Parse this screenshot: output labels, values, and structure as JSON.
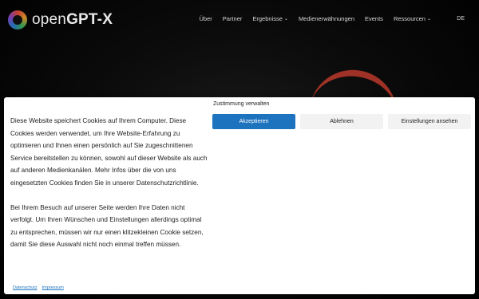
{
  "header": {
    "logo": {
      "prefix": "open",
      "suffix": "GPT-X"
    },
    "nav": [
      {
        "label": "Über",
        "has_dropdown": false
      },
      {
        "label": "Partner",
        "has_dropdown": false
      },
      {
        "label": "Ergebnisse",
        "has_dropdown": true
      },
      {
        "label": "Medienerwähnungen",
        "has_dropdown": false
      },
      {
        "label": "Events",
        "has_dropdown": false
      },
      {
        "label": "Ressourcen",
        "has_dropdown": true
      }
    ],
    "language": "DE"
  },
  "cookie_banner": {
    "title": "Zustimmung verwalten",
    "paragraphs": [
      "Diese Website speichert Cookies auf Ihrem Computer. Diese Cookies werden verwendet, um Ihre Website-Erfahrung zu optimieren und Ihnen einen persönlich auf Sie zugeschnittenen Service bereitstellen zu können, sowohl auf dieser Website als auch auf anderen Medienkanälen. Mehr Infos über die von uns eingesetzten Cookies finden Sie in unserer Datenschutzrichtlinie.",
      "Bei Ihrem Besuch auf unserer Seite werden Ihre Daten nicht verfolgt. Um Ihren Wünschen und Einstellungen allerdings optimal zu entsprechen, müssen wir nur einen klitzekleinen Cookie setzen, damit Sie diese Auswahl nicht noch einmal treffen müssen."
    ],
    "buttons": {
      "accept": "Akzeptieren",
      "decline": "Ablehnen",
      "settings": "Einstellungen ansehen"
    },
    "links": {
      "privacy": "Datenschutz",
      "imprint": "Impressum"
    }
  },
  "colors": {
    "accent": "#1e73be",
    "background": "#000000",
    "banner": "#ffffff"
  },
  "icons": {
    "dropdown": "chevron-down-icon",
    "logo": "opengptx-logo-icon"
  }
}
